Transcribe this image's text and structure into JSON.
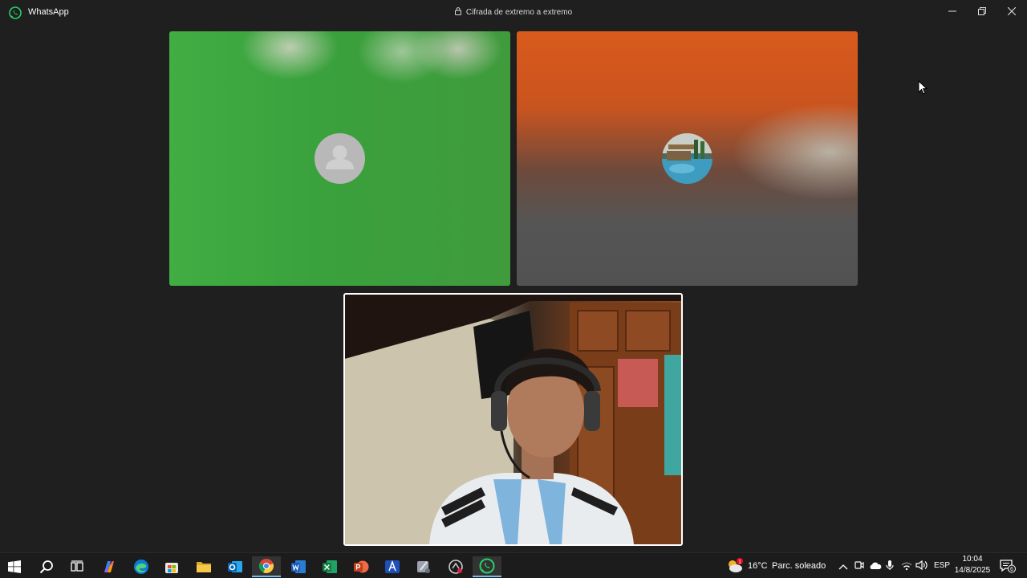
{
  "window": {
    "app_name": "WhatsApp",
    "encryption_label": "Cifrada de extremo a extremo"
  },
  "call": {
    "participants": [
      {
        "avatar": "default-person-icon"
      },
      {
        "avatar": "pool-photo-avatar"
      }
    ],
    "self_view": "local-camera-video"
  },
  "taskbar": {
    "weather": {
      "temperature": "16°C",
      "condition": "Parc. soleado",
      "badge": "1"
    },
    "language": "ESP",
    "time": "10:04",
    "date": "14/8/2025",
    "notifications_count": "6",
    "apps": [
      "windows-start-icon",
      "search-icon",
      "task-view-icon",
      "copilot-icon",
      "edge-icon",
      "store-icon",
      "file-explorer-icon",
      "outlook-icon",
      "chrome-icon",
      "word-icon",
      "excel-icon",
      "powerpoint-icon",
      "azure-app-icon",
      "app-icon",
      "app-red-icon",
      "whatsapp-icon"
    ]
  },
  "colors": {
    "background": "#1f1f1f",
    "whatsapp_green": "#25d366",
    "taskbar": "#1c1c1c"
  }
}
